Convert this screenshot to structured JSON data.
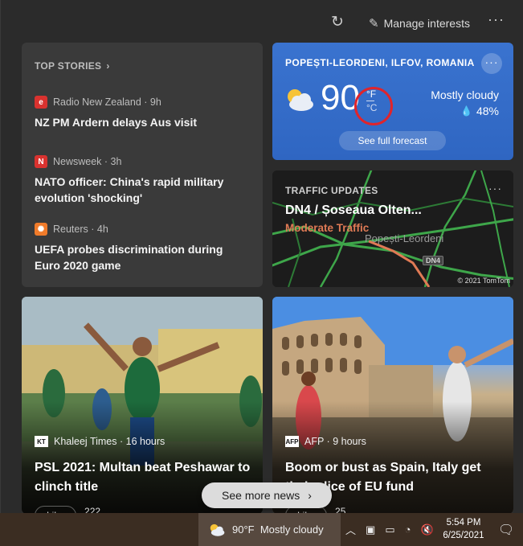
{
  "header": {
    "manage_label": "Manage interests",
    "more_label": "···"
  },
  "top_stories": {
    "heading": "TOP STORIES",
    "chevron": "›",
    "items": [
      {
        "source": "Radio New Zealand · 9h",
        "logo": "e",
        "logo_color": "#d9322f",
        "headline": "NZ PM Ardern delays Aus visit"
      },
      {
        "source": "Newsweek · 3h",
        "logo": "N",
        "logo_color": "#d9322f",
        "headline": "NATO officer: China's rapid military evolution 'shocking'"
      },
      {
        "source": "Reuters · 4h",
        "logo": "✺",
        "logo_color": "#f07b2a",
        "headline": "UEFA probes discrimination during Euro 2020 game"
      }
    ]
  },
  "weather": {
    "location": "POPEȘTI-LEORDENI, ILFOV, ROMANIA",
    "more": "···",
    "temp": "90",
    "unit_f": "°F",
    "unit_c": "°C",
    "condition": "Mostly cloudy",
    "humidity": "48%",
    "forecast_btn": "See full forecast",
    "accent": "#3a73cf"
  },
  "traffic": {
    "label": "TRAFFIC UPDATES",
    "road": "DN4 / Șoseaua Olten...",
    "status": "Moderate Traffic",
    "town": "Popești-Leordeni",
    "shield": "DN4",
    "copyright": "© 2021 TomTom",
    "status_color": "#e07a55"
  },
  "news": [
    {
      "source": "Khaleej Times · 16 hours",
      "logo": "KT",
      "headline": "PSL 2021: Multan beat Peshawar to clinch title",
      "like": "Like",
      "reactions": "222"
    },
    {
      "source": "AFP · 9 hours",
      "logo": "AFP",
      "headline": "Boom or bust as Spain, Italy get their slice of EU fund",
      "like": "Like",
      "reactions": "25"
    }
  ],
  "see_more": {
    "label": "See more news",
    "chevron": "›"
  },
  "taskbar": {
    "weather": "90°F  Mostly cloudy",
    "time": "5:54 PM",
    "date": "6/25/2021"
  }
}
